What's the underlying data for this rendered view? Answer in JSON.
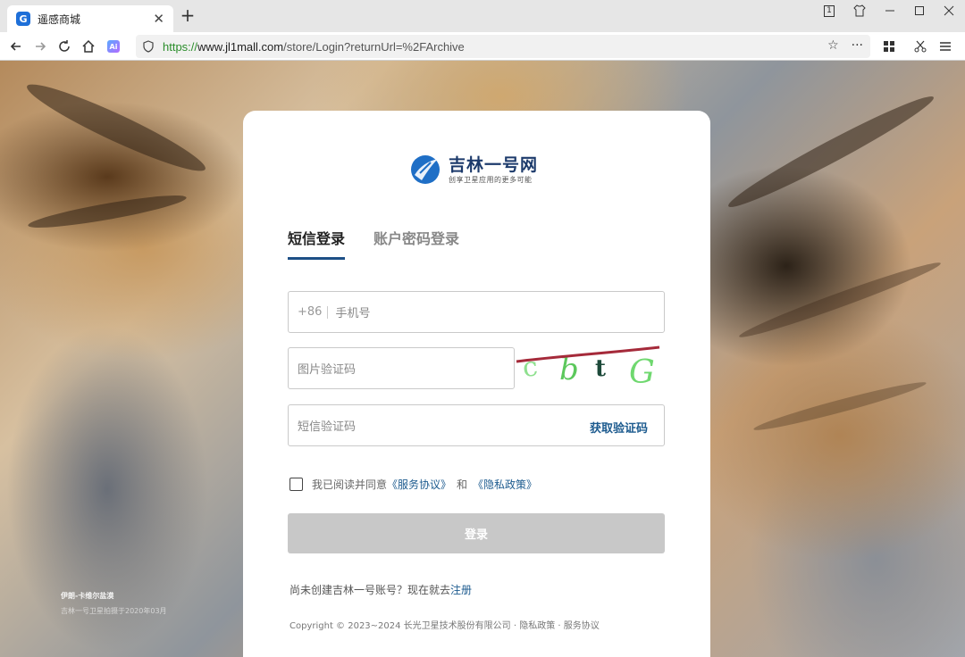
{
  "browser": {
    "tab_title": "遥感商城",
    "new_tab": "+",
    "url_scheme": "https://",
    "url_host": "www.jl1mall.com",
    "url_path": "/store/Login?returnUrl=%2FArchive",
    "window_count": "1"
  },
  "logo": {
    "title": "吉林一号网",
    "subtitle": "创享卫星应用的更多可能"
  },
  "tabs": {
    "sms_login": "短信登录",
    "password_login": "账户密码登录"
  },
  "form": {
    "phone_prefix": "+86",
    "phone_placeholder": "手机号",
    "captcha_placeholder": "图片验证码",
    "captcha_text": "cbtG",
    "sms_placeholder": "短信验证码",
    "get_code": "获取验证码"
  },
  "agreement": {
    "prefix": "我已阅读并同意",
    "service": "《服务协议》",
    "and": "和",
    "privacy": "《隐私政策》"
  },
  "login_button": "登录",
  "register": {
    "text": "尚未创建吉林一号账号？现在就去",
    "link": "注册"
  },
  "copyright": "Copyright © 2023~2024 长光卫星技术股份有限公司 · 隐私政策 · 服务协议",
  "caption": {
    "title": "伊朗-卡维尔盐漠",
    "sub": "吉林一号卫星拍摄于2020年03月"
  },
  "colors": {
    "accent": "#1d5b8f",
    "tab_underline": "#1d4f86",
    "button_disabled": "#c8c8c8"
  }
}
